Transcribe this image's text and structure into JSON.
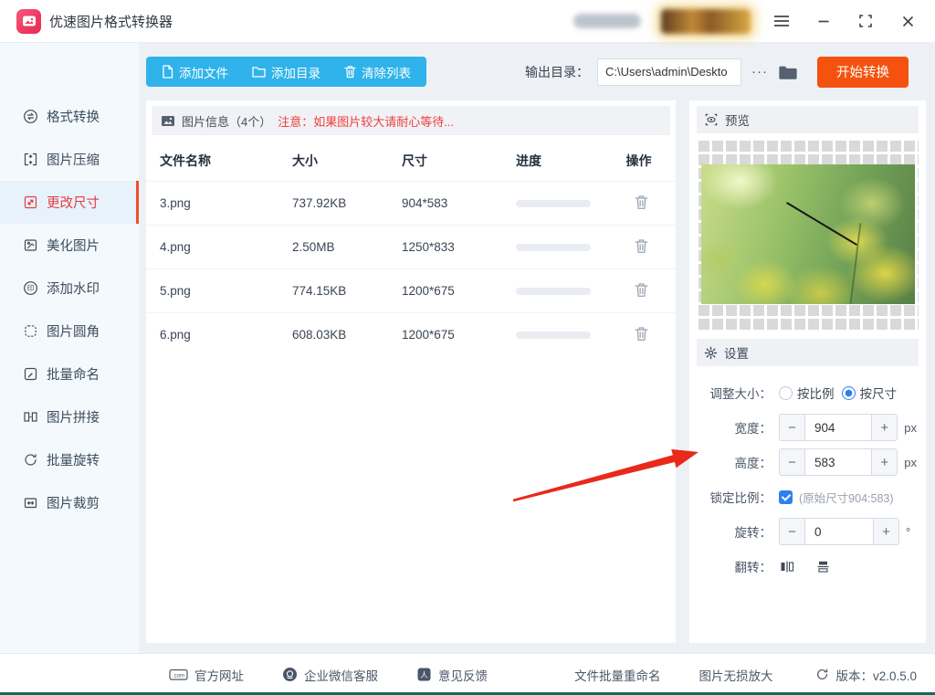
{
  "colors": {
    "accent_blue": "#2fb3ea",
    "accent_orange": "#f4520e",
    "active_red": "#e23d3d",
    "control_blue": "#2e80f0",
    "warning_red": "#f03e3e"
  },
  "titlebar": {
    "title": "优速图片格式转换器"
  },
  "toolbar": {
    "add_file": "添加文件",
    "add_folder": "添加目录",
    "clear_list": "清除列表",
    "output_label": "输出目录：",
    "output_value": "C:\\Users\\admin\\Deskto",
    "more": "···",
    "start": "开始转换"
  },
  "sidebar": {
    "items": [
      {
        "label": "格式转换"
      },
      {
        "label": "图片压缩"
      },
      {
        "label": "更改尺寸"
      },
      {
        "label": "美化图片"
      },
      {
        "label": "添加水印"
      },
      {
        "label": "图片圆角"
      },
      {
        "label": "批量命名"
      },
      {
        "label": "图片拼接"
      },
      {
        "label": "批量旋转"
      },
      {
        "label": "图片裁剪"
      }
    ]
  },
  "filelist": {
    "info_title": "图片信息（4个）",
    "info_warning": "注意：如果图片较大请耐心等待...",
    "columns": {
      "name": "文件名称",
      "size": "大小",
      "dims": "尺寸",
      "progress": "进度",
      "action": "操作"
    },
    "rows": [
      {
        "name": "3.png",
        "size": "737.92KB",
        "dims": "904*583"
      },
      {
        "name": "4.png",
        "size": "2.50MB",
        "dims": "1250*833"
      },
      {
        "name": "5.png",
        "size": "774.15KB",
        "dims": "1200*675"
      },
      {
        "name": "6.png",
        "size": "608.03KB",
        "dims": "1200*675"
      }
    ]
  },
  "preview": {
    "title": "预览"
  },
  "settings": {
    "title": "设置",
    "resize_label": "调整大小：",
    "radio_ratio": "按比例",
    "radio_size": "按尺寸",
    "width_label": "宽度：",
    "width_value": "904",
    "height_label": "高度：",
    "height_value": "583",
    "px_unit": "px",
    "lock_label": "锁定比例：",
    "lock_hint": "(原始尺寸904:583)",
    "rotate_label": "旋转：",
    "rotate_value": "0",
    "degree_unit": "°",
    "flip_label": "翻转："
  },
  "footer": {
    "website": "官方网址",
    "wechat_support": "企业微信客服",
    "feedback": "意见反馈",
    "batch_rename": "文件批量重命名",
    "lossless_upscale": "图片无损放大",
    "version": "版本：v2.0.5.0"
  }
}
